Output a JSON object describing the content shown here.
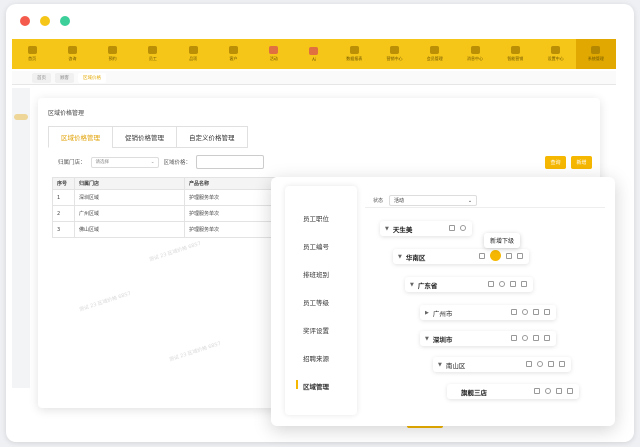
{
  "window_dots": {
    "red": "#f45b4c",
    "yellow": "#f5c518",
    "green": "#3ccf9a"
  },
  "toolbar": {
    "items": [
      {
        "label": "首页"
      },
      {
        "label": "咨询"
      },
      {
        "label": "预约"
      },
      {
        "label": "员工"
      },
      {
        "label": "品项"
      },
      {
        "label": "客户"
      },
      {
        "label": "活动"
      },
      {
        "label": "Ai"
      },
      {
        "label": "数据报表"
      },
      {
        "label": "营销中心"
      },
      {
        "label": "会员管理"
      },
      {
        "label": "消息中心"
      },
      {
        "label": "智能营销"
      },
      {
        "label": "设置中心"
      },
      {
        "label": "系统管理"
      }
    ]
  },
  "page_tabs": [
    "首页",
    "顾客",
    "区域价格"
  ],
  "panel1": {
    "title": "区域价格管理",
    "tabs": [
      "区域价格管理",
      "促销价格管理",
      "自定义价格管理"
    ],
    "filter_store_label": "归属门店：",
    "filter_store_value": "请选择",
    "filter_price_label": "区域价格：",
    "btn_query": "查询",
    "btn_add": "新增",
    "columns": [
      "序号",
      "归属门店",
      "产品名称"
    ],
    "rows": [
      [
        "1",
        "深圳区域",
        "护理服务单次"
      ],
      [
        "2",
        "广州区域",
        "护理服务单次"
      ],
      [
        "3",
        "佛山区域",
        "护理服务单次"
      ]
    ],
    "watermark": "测试 23 区域价格 6857"
  },
  "panel2": {
    "menu": [
      "员工职位",
      "员工编号",
      "排班班别",
      "员工等级",
      "奖评设置",
      "招聘来源",
      "区域管理"
    ],
    "status_label": "状态",
    "status_value": "活动",
    "nodes": [
      "天生美",
      "华南区",
      "广东省",
      "广州市",
      "深圳市",
      "南山区",
      "旗舰三店"
    ],
    "tooltip": "新增下级"
  }
}
